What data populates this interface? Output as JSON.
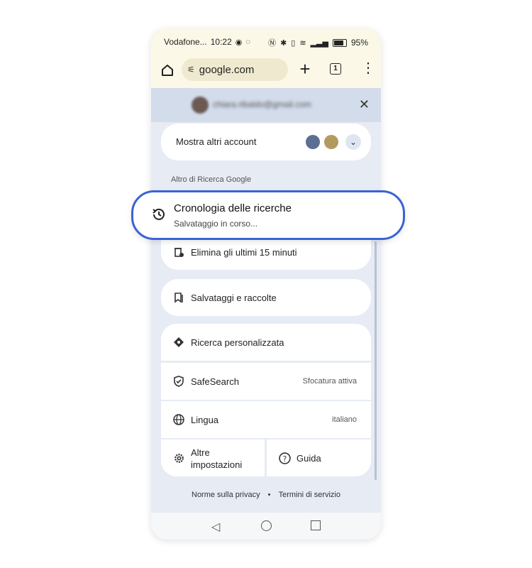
{
  "status_bar": {
    "carrier": "Vodafone...",
    "time": "10:22",
    "battery": "95%"
  },
  "toolbar": {
    "url": "google.com",
    "tab_count": "1",
    "plus": "+",
    "menu": "⋮"
  },
  "account": {
    "email": "chiara.ribaldo@gmail.com",
    "close": "✕"
  },
  "more_accounts": {
    "label": "Mostra altri account",
    "chevron": "⌄"
  },
  "section_title": "Altro di Ricerca Google",
  "history": {
    "title": "Cronologia delle ricerche",
    "subtitle": "Salvataggio in corso..."
  },
  "items": {
    "delete": "Elimina gli ultimi 15 minuti",
    "saves": "Salvataggi e raccolte",
    "personal": "Ricerca personalizzata",
    "safesearch": "SafeSearch",
    "safesearch_value": "Sfocatura attiva",
    "language": "Lingua",
    "language_value": "italiano",
    "settings": "Altre impostazioni",
    "help": "Guida"
  },
  "footer": {
    "privacy": "Norme sulla privacy",
    "separator": "•",
    "terms": "Termini di servizio"
  },
  "colors": {
    "accent": "#3b63d6",
    "panel": "#e6ebf4",
    "toolbar": "#fbf8e8"
  }
}
